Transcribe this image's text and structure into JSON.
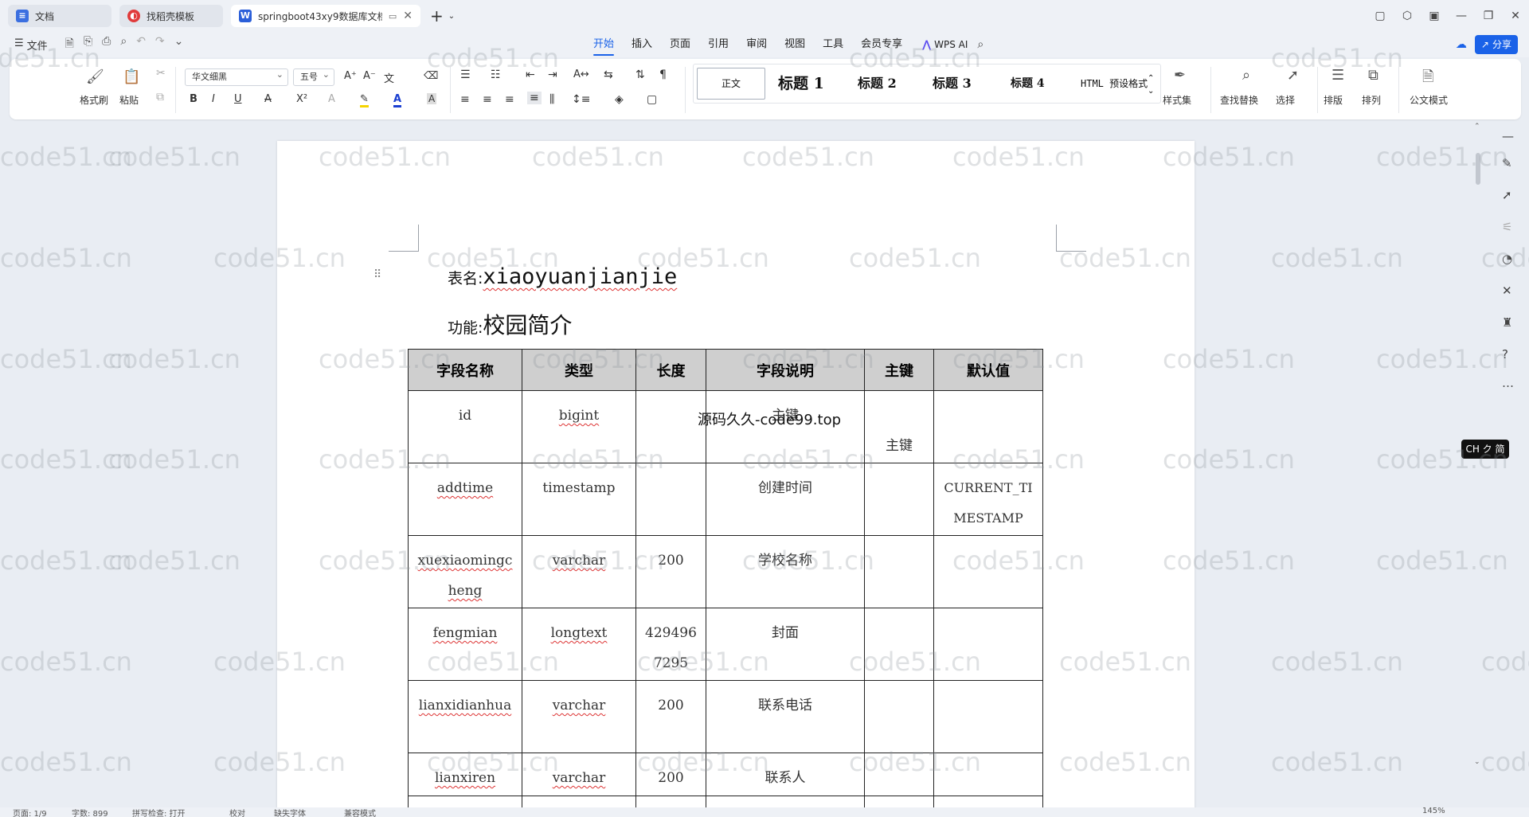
{
  "tabs": [
    {
      "label": "文档",
      "icon": "docs-icon",
      "color": "#3b6fe0",
      "active": false
    },
    {
      "label": "找稻壳模板",
      "icon": "docer-icon",
      "color": "#e03b3b",
      "active": false
    },
    {
      "label": "springboot43xy9数据库文档",
      "icon": "word-icon",
      "color": "#2b5fd9",
      "active": true
    }
  ],
  "menubar": {
    "file": "文件",
    "items": [
      "开始",
      "插入",
      "页面",
      "引用",
      "审阅",
      "视图",
      "工具",
      "会员专享"
    ],
    "selected": "开始",
    "wps_ai": "WPS AI",
    "share": "分享"
  },
  "ribbon": {
    "format_painter": "格式刷",
    "paste": "粘贴",
    "font_name": "华文细黑",
    "font_size": "五号",
    "styles": [
      "正文",
      "标题 1",
      "标题 2",
      "标题 3",
      "标题 4",
      "HTML 预设格式"
    ],
    "style_set": "样式集",
    "find_replace": "查找替换",
    "select": "选择",
    "typeset": "排版",
    "arrange": "排列",
    "official_mode": "公文模式"
  },
  "document": {
    "table_name_label": "表名:",
    "table_name": "xiaoyuanjianjie",
    "function_label": "功能:",
    "function_value": "校园简介",
    "overlay_text": "源码久久-code99.top",
    "columns": [
      "字段名称",
      "类型",
      "长度",
      "字段说明",
      "主键",
      "默认值"
    ],
    "rows": [
      {
        "name": "id",
        "type": "bigint",
        "length": "",
        "desc": "主键",
        "pk": "主键",
        "default": ""
      },
      {
        "name": "addtime",
        "type": "timestamp",
        "length": "",
        "desc": "创建时间",
        "pk": "",
        "default": "CURRENT_TIMESTAMP"
      },
      {
        "name": "xuexiaomingcheng",
        "type": "varchar",
        "length": "200",
        "desc": "学校名称",
        "pk": "",
        "default": ""
      },
      {
        "name": "fengmian",
        "type": "longtext",
        "length": "4294967295",
        "desc": "封面",
        "pk": "",
        "default": ""
      },
      {
        "name": "lianxidianhua",
        "type": "varchar",
        "length": "200",
        "desc": "联系电话",
        "pk": "",
        "default": ""
      },
      {
        "name": "lianxiren",
        "type": "varchar",
        "length": "200",
        "desc": "联系人",
        "pk": "",
        "default": ""
      }
    ]
  },
  "watermark": "code51.cn",
  "ime_badge": "CH ク 简",
  "statusbar": {
    "page": "页面: 1/9",
    "words": "字数: 899",
    "spell": "拼写检查: 打开",
    "proof": "校对",
    "font_missing": "缺失字体",
    "compat": "兼容模式",
    "zoom": "145%"
  }
}
